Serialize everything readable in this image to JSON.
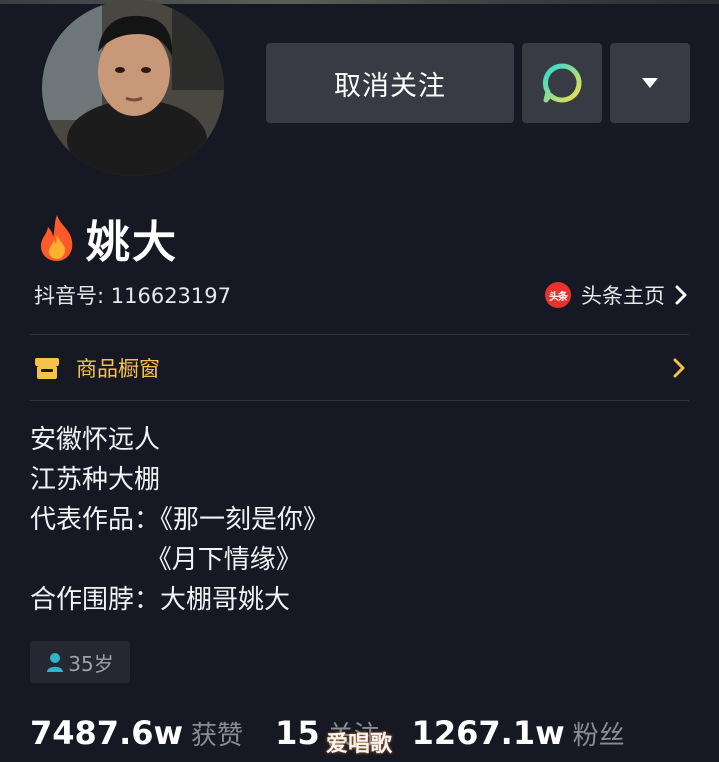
{
  "profile": {
    "name": "姚大",
    "douyin_id": "抖音号: 116623197",
    "unfollow_label": "取消关注",
    "toutiao_badge": "头条",
    "toutiao_label": "头条主页"
  },
  "shop": {
    "label": "商品橱窗"
  },
  "bio": {
    "lines": [
      "安徽怀远人",
      "江苏种大棚",
      "代表作品：《那一刻是你》",
      "              《月下情缘》",
      "合作围脖：大棚哥姚大"
    ]
  },
  "age": "35岁",
  "stats": [
    {
      "value": "7487.6w",
      "label": "获赞"
    },
    {
      "value": "15",
      "label": "关注"
    },
    {
      "value": "1267.1w",
      "label": "粉丝"
    }
  ],
  "watermark": "爱唱歌",
  "colors": {
    "background": "#161823",
    "button": "#393b44",
    "shop_accent": "#f5c24a",
    "toutiao_red": "#e8322e",
    "chat_ring_start": "#2bd9d9",
    "chat_ring_end": "#f5e047"
  },
  "icons": {
    "fire": "fire-icon",
    "chat": "chat-bubble-icon",
    "more": "caret-down-icon",
    "shop": "shop-icon",
    "chevron": "chevron-right-icon",
    "age": "person-icon"
  }
}
